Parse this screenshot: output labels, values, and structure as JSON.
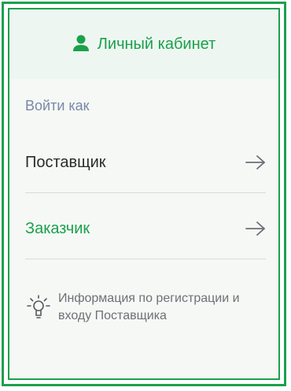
{
  "header": {
    "icon": "user-icon",
    "title": "Личный кабинет"
  },
  "login_as": "Войти как",
  "options": [
    {
      "label": "Поставщик",
      "icon": "arrow-right-icon"
    },
    {
      "label": "Заказчик",
      "icon": "arrow-right-icon"
    }
  ],
  "info": {
    "icon": "lightbulb-icon",
    "text": "Информация по регистрации и входу Поставщика"
  },
  "colors": {
    "accent": "#1aa14c",
    "muted": "#7a88a8",
    "text": "#2b2b2b",
    "header_bg": "#eef6f1"
  }
}
